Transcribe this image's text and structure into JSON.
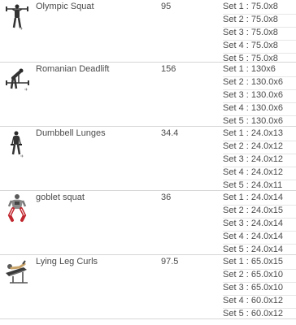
{
  "exercises": [
    {
      "icon": "olympic-squat-figure-icon",
      "name": "Olympic Squat",
      "volume": "95",
      "sets": [
        "Set 1 : 75.0x8",
        "Set 2 : 75.0x8",
        "Set 3 : 75.0x8",
        "Set 4 : 75.0x8",
        "Set 5 : 75.0x8"
      ]
    },
    {
      "icon": "romanian-deadlift-figure-icon",
      "name": "Romanian Deadlift",
      "volume": "156",
      "sets": [
        "Set 1 : 130x6",
        "Set 2 : 130.0x6",
        "Set 3 : 130.0x6",
        "Set 4 : 130.0x6",
        "Set 5 : 130.0x6"
      ]
    },
    {
      "icon": "dumbbell-lunges-figure-icon",
      "name": "Dumbbell Lunges",
      "volume": "34.4",
      "sets": [
        "Set 1 : 24.0x13",
        "Set 2 : 24.0x12",
        "Set 3 : 24.0x12",
        "Set 4 : 24.0x12",
        "Set 5 : 24.0x11"
      ]
    },
    {
      "icon": "goblet-squat-figure-icon",
      "name": "goblet squat",
      "volume": "36",
      "sets": [
        "Set 1 : 24.0x14",
        "Set 2 : 24.0x15",
        "Set 3 : 24.0x14",
        "Set 4 : 24.0x14",
        "Set 5 : 24.0x14"
      ]
    },
    {
      "icon": "lying-leg-curls-figure-icon",
      "name": "Lying Leg Curls",
      "volume": "97.5",
      "sets": [
        "Set 1 : 65.0x15",
        "Set 2 : 65.0x10",
        "Set 3 : 65.0x10",
        "Set 4 : 60.0x12",
        "Set 5 : 60.0x12"
      ]
    }
  ]
}
